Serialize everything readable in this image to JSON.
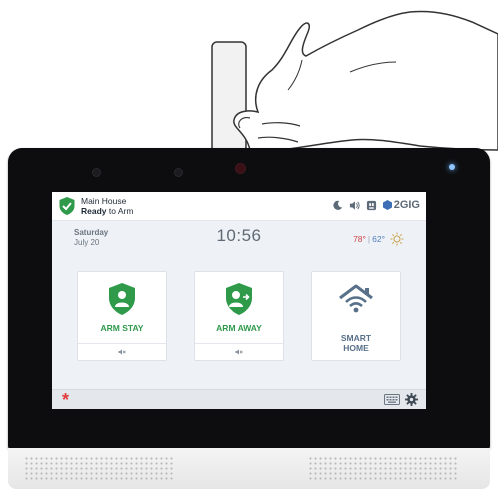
{
  "status_bar": {
    "location": "Main House",
    "arm_state_bold": "Ready",
    "arm_state_rest": " to Arm",
    "brand": "2GIG"
  },
  "info_row": {
    "day": "Saturday",
    "date": "July 20",
    "time": "10:56",
    "temp_high": "78°",
    "temp_separator": "|",
    "temp_low": "62°",
    "weather_icon": "sun-icon"
  },
  "tiles": [
    {
      "label": "ARM STAY",
      "icon": "arm-stay-shield-icon",
      "color": "#2e9a4a",
      "mute_icon": "mute-icon"
    },
    {
      "label": "ARM AWAY",
      "icon": "arm-away-shield-icon",
      "color": "#2e9a4a",
      "mute_icon": "mute-icon"
    },
    {
      "label_line1": "SMART",
      "label_line2": "HOME",
      "icon": "smart-home-wifi-icon",
      "color": "#59708a"
    }
  ],
  "bottom_bar": {
    "emergency_icon": "asterisk-icon",
    "emergency_glyph": "*",
    "keypad_icon": "keypad-icon",
    "settings_icon": "gear-icon"
  },
  "colors": {
    "accent_green": "#2e9a4a",
    "temp_high": "#d0454d",
    "temp_low": "#4f7fc1",
    "emergency_red": "#e23b3b"
  }
}
